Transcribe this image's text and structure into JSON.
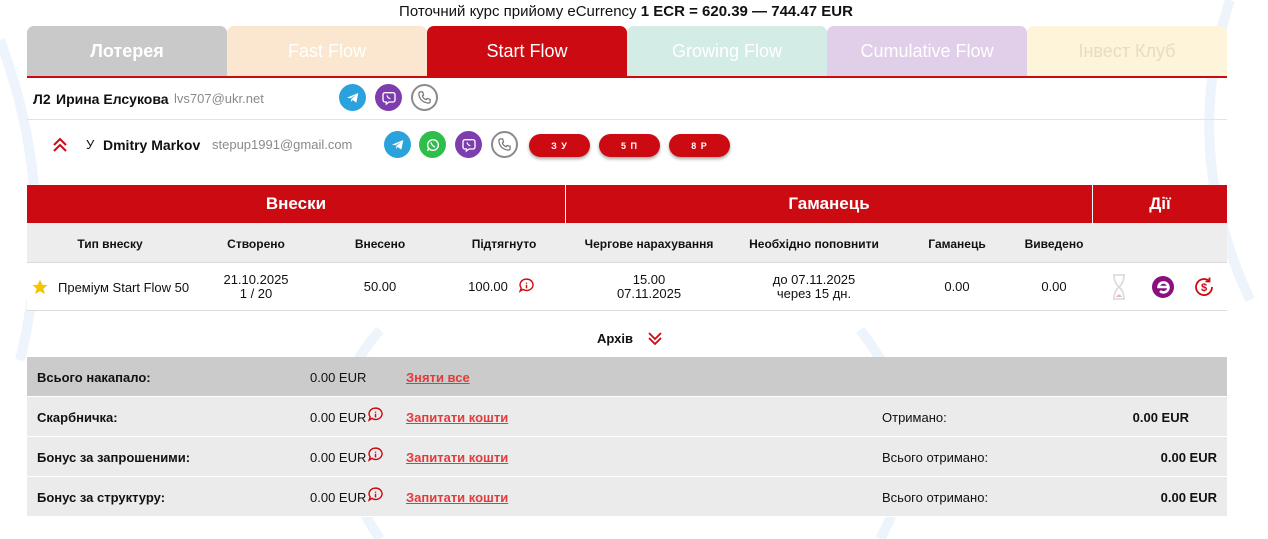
{
  "rate": {
    "prefix": "Поточний курс прийому eCurrency",
    "value": "1 ECR = 620.39 — 744.47 EUR"
  },
  "tabs": [
    {
      "label": "Лотерея",
      "active": false
    },
    {
      "label": "Fast Flow",
      "active": false
    },
    {
      "label": "Start Flow",
      "active": true
    },
    {
      "label": "Growing Flow",
      "active": false
    },
    {
      "label": "Cumulative Flow",
      "active": false
    },
    {
      "label": "Інвест Клуб",
      "active": false
    }
  ],
  "user": {
    "level": "Л2",
    "name": "Ирина Елсукова",
    "email": "lvs707@ukr.net",
    "icons": [
      "telegram-icon",
      "viber-icon",
      "phone-icon"
    ]
  },
  "sponsor": {
    "prefix": "У",
    "name": "Dmitry Markov",
    "email": "stepup1991@gmail.com",
    "icons": [
      "telegram-icon",
      "whatsapp-icon",
      "viber-icon",
      "phone-icon"
    ],
    "pills": [
      "З У",
      "5 П",
      "8 Р"
    ]
  },
  "table": {
    "groups": [
      "Внески",
      "Гаманець",
      "Дії"
    ],
    "columns": [
      "Тип внеску",
      "Створено",
      "Внесено",
      "Підтягнуто",
      "Чергове нарахування",
      "Необхідно поповнити",
      "Гаманець",
      "Виведено"
    ],
    "row": {
      "type": "Преміум Start Flow 50",
      "created_date": "21.10.2025",
      "created_count": "1 / 20",
      "deposited": "50.00",
      "pulled": "100.00",
      "next_amount": "15.00",
      "next_date": "07.11.2025",
      "topup_date": "до 07.11.2025",
      "topup_days": "через 15 дн.",
      "wallet": "0.00",
      "withdrawn": "0.00"
    }
  },
  "archive_label": "Архів",
  "summary": [
    {
      "label": "Всього накапало:",
      "value": "0.00 EUR",
      "link": "Зняти все",
      "info": false,
      "right_label": "",
      "right_value": ""
    },
    {
      "label": "Скарбничка:",
      "value": "0.00 EUR",
      "link": "Запитати кошти",
      "info": true,
      "right_label": "Отримано:",
      "right_value": "0.00 EUR"
    },
    {
      "label": "Бонус за запрошеними:",
      "value": "0.00 EUR",
      "link": "Запитати кошти",
      "info": true,
      "right_label": "Всього отримано:",
      "right_value": "0.00 EUR"
    },
    {
      "label": "Бонус за структуру:",
      "value": "0.00 EUR",
      "link": "Запитати кошти",
      "info": true,
      "right_label": "Всього отримано:",
      "right_value": "0.00 EUR"
    }
  ],
  "colors": {
    "accent": "#cc0a12",
    "link": "#e03c3c"
  }
}
